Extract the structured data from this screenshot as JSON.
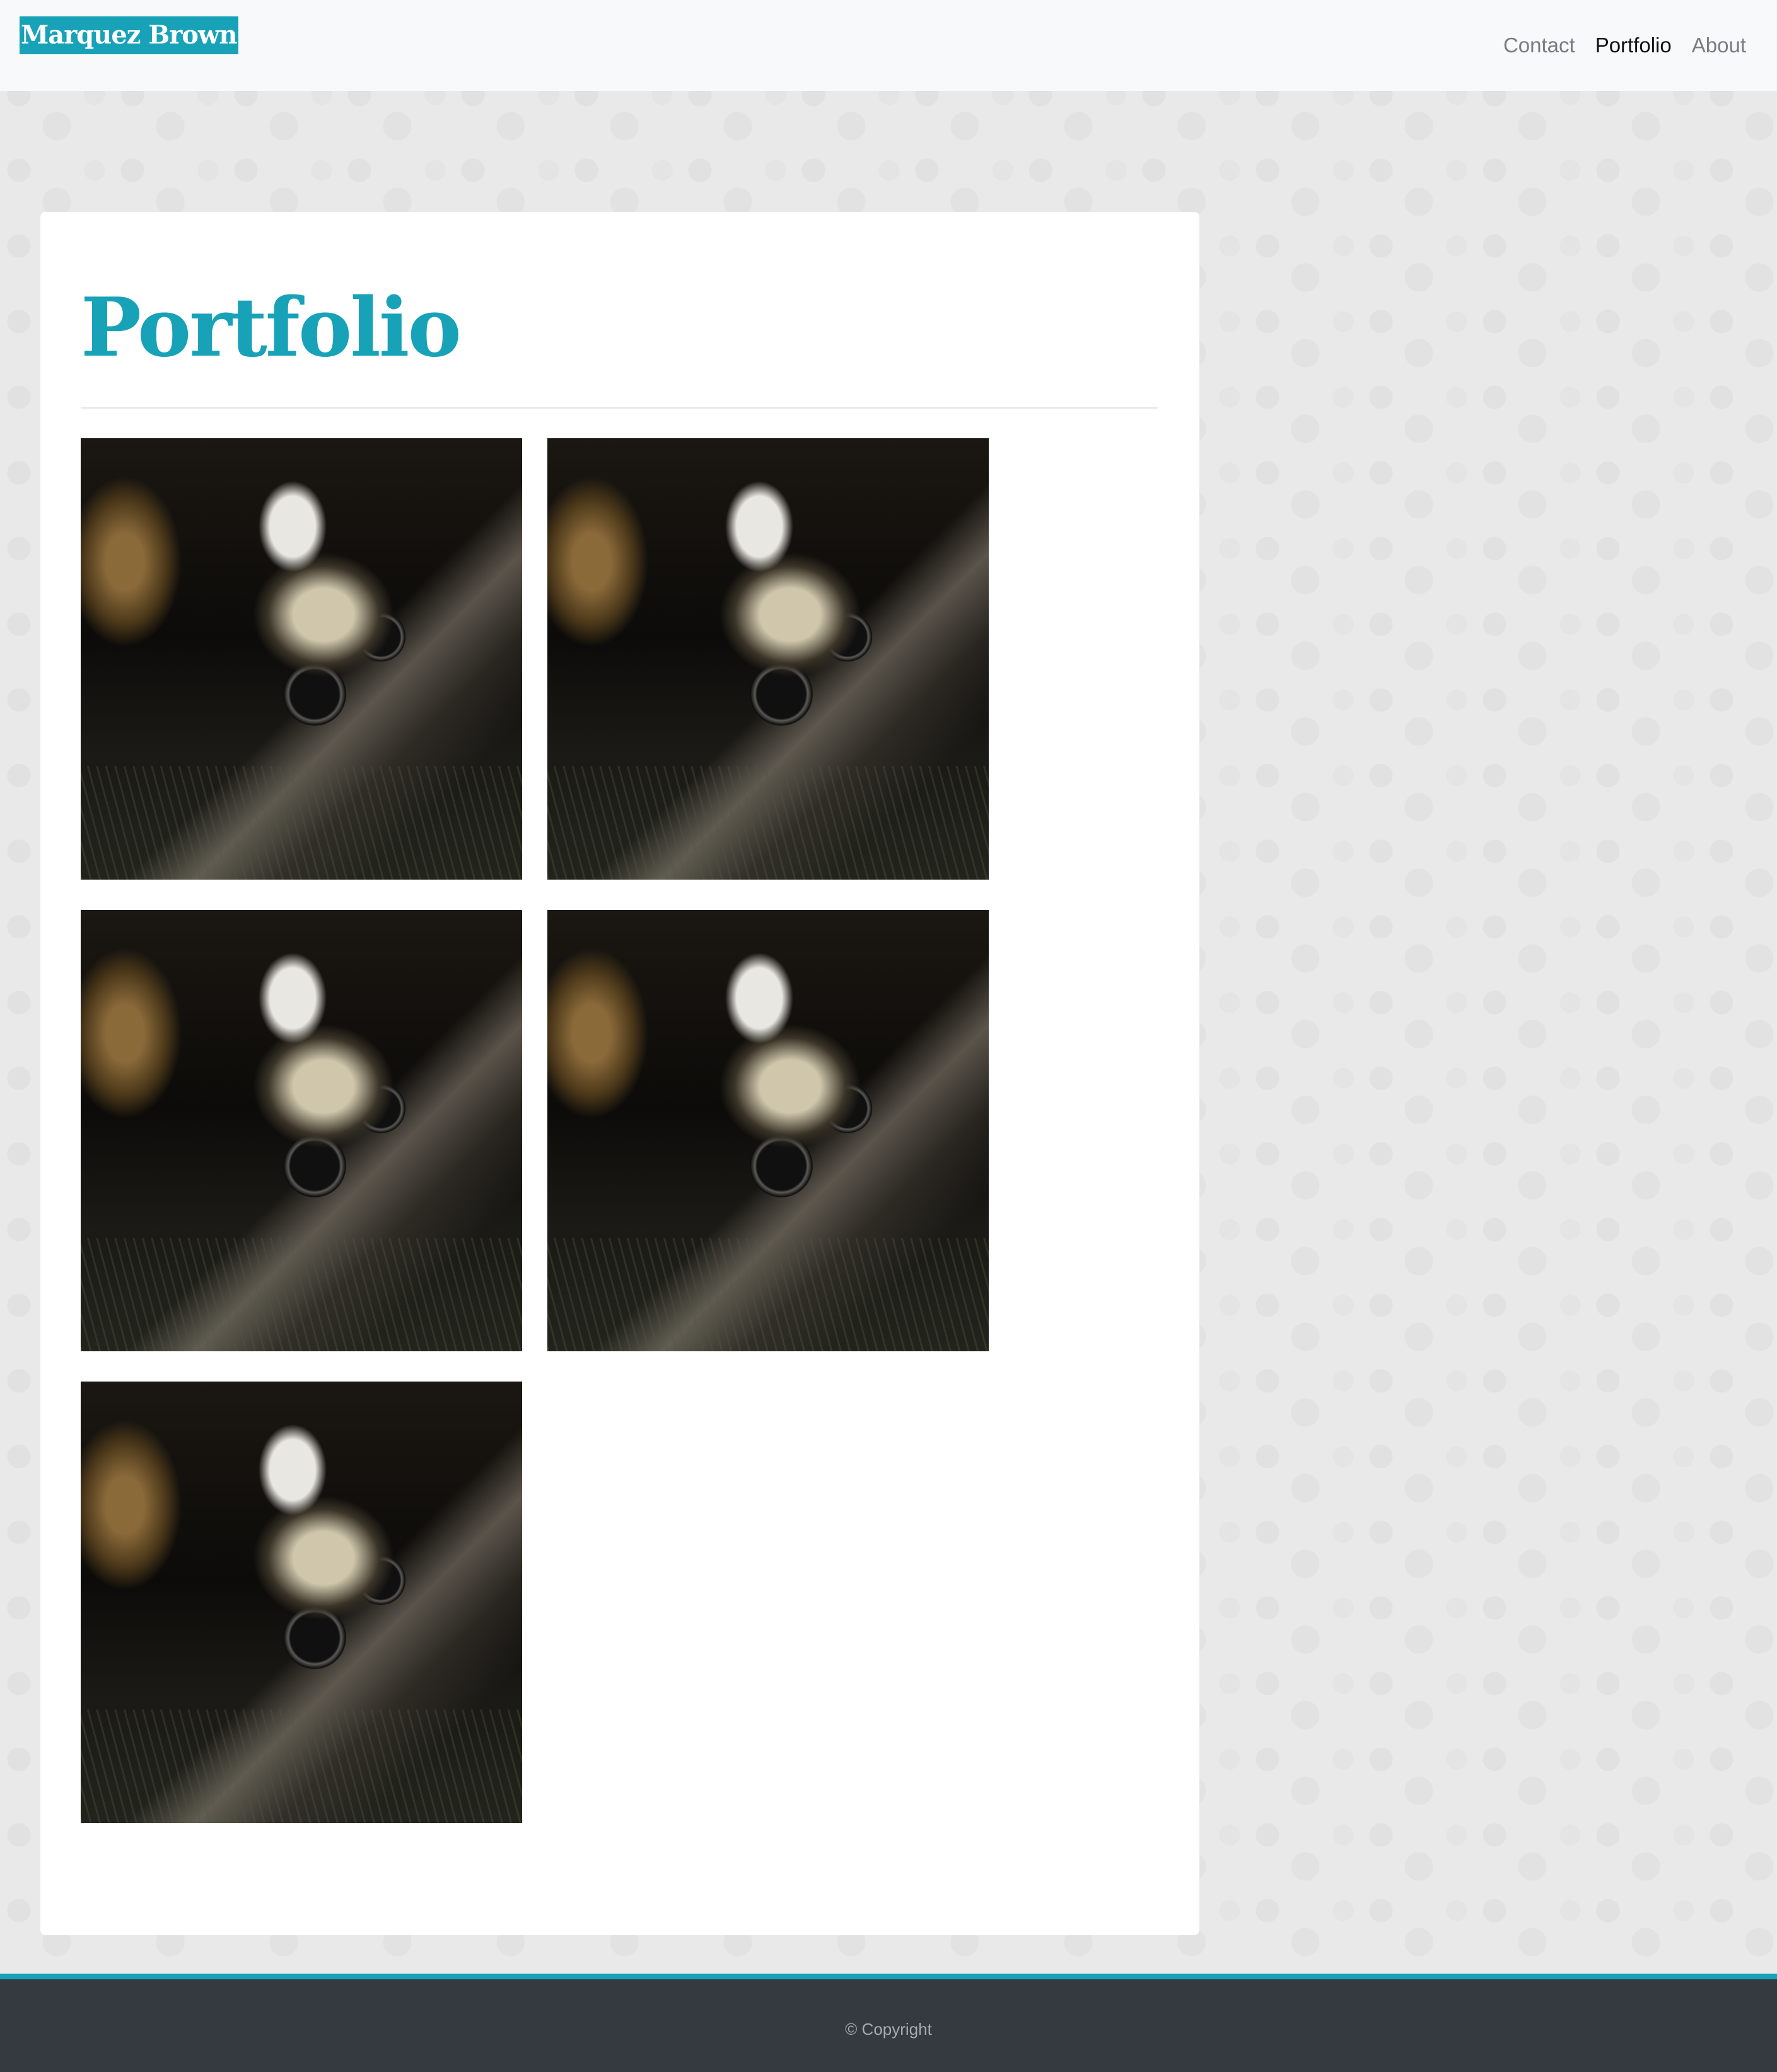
{
  "navbar": {
    "brand": "Marquez Brown",
    "links": [
      {
        "label": "Contact",
        "active": false
      },
      {
        "label": "Portfolio",
        "active": true
      },
      {
        "label": "About",
        "active": false
      }
    ]
  },
  "main": {
    "title": "Portfolio",
    "gallery": [
      {
        "alt": "ATV rider photo"
      },
      {
        "alt": "ATV rider photo"
      },
      {
        "alt": "ATV rider photo"
      },
      {
        "alt": "ATV rider photo"
      },
      {
        "alt": "ATV rider photo"
      }
    ]
  },
  "footer": {
    "copyright": "© Copyright"
  },
  "colors": {
    "accent": "#17a2b8",
    "navbar_bg": "#f8f9fa",
    "footer_bg": "#343a40",
    "page_bg": "#e9e9e9"
  }
}
